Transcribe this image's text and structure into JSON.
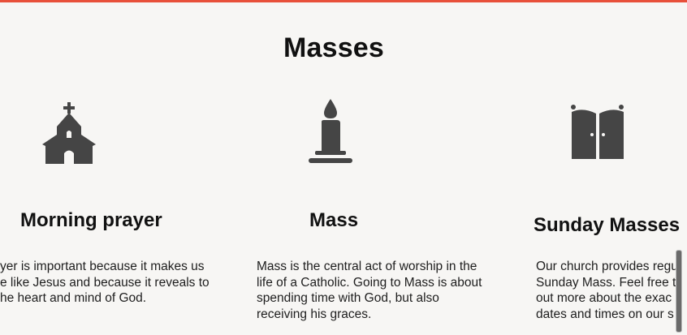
{
  "accent_color": "#e8503a",
  "section": {
    "title": "Masses"
  },
  "cards": [
    {
      "icon": "church-icon",
      "title": "Morning prayer",
      "text_lines": [
        "yer is important because it makes us",
        "e like Jesus and because it reveals to",
        "he heart and mind of God."
      ]
    },
    {
      "icon": "candle-icon",
      "title": "Mass",
      "text_lines": [
        "Mass is the central act of worship in the",
        "life of a Catholic. Going to Mass is about",
        "spending time with God, but also",
        "receiving his graces."
      ]
    },
    {
      "icon": "church-doors-icon",
      "title": "Sunday Masses",
      "text_lines": [
        "Our church provides regu",
        "Sunday Mass. Feel free t",
        "out more about the exac",
        "dates and times on our s"
      ]
    }
  ]
}
